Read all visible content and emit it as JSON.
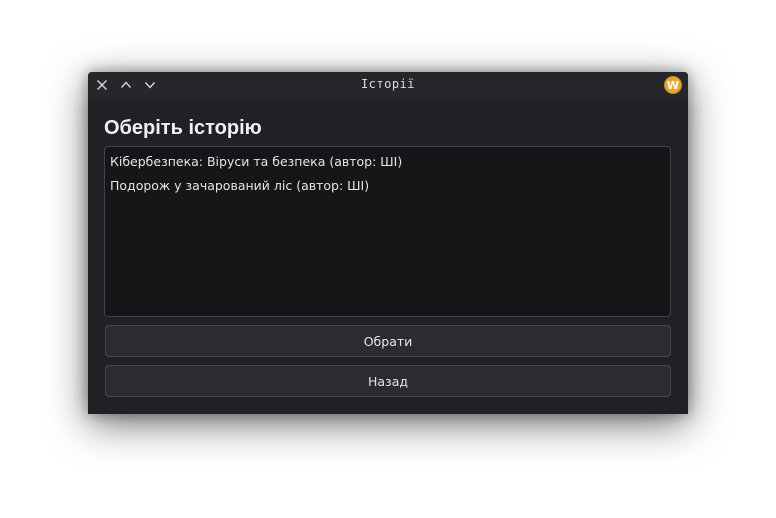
{
  "window": {
    "title": "Історії",
    "app_icon_letter": "W",
    "icons": {
      "close": "close-icon",
      "maximize": "chevron-up-icon",
      "minimize": "chevron-down-icon"
    }
  },
  "main": {
    "heading": "Оберіть історію",
    "stories": [
      "Кібербезпека: Віруси та безпека (автор: ШІ)",
      "Подорож у зачарований ліс (автор: ШІ)"
    ],
    "select_button_label": "Обрати",
    "back_button_label": "Назад"
  },
  "colors": {
    "window_bg": "#1f2124",
    "titlebar_bg": "#25272b",
    "list_bg": "#151618",
    "button_bg": "#2a2c30",
    "app_icon": "#e7a531"
  }
}
